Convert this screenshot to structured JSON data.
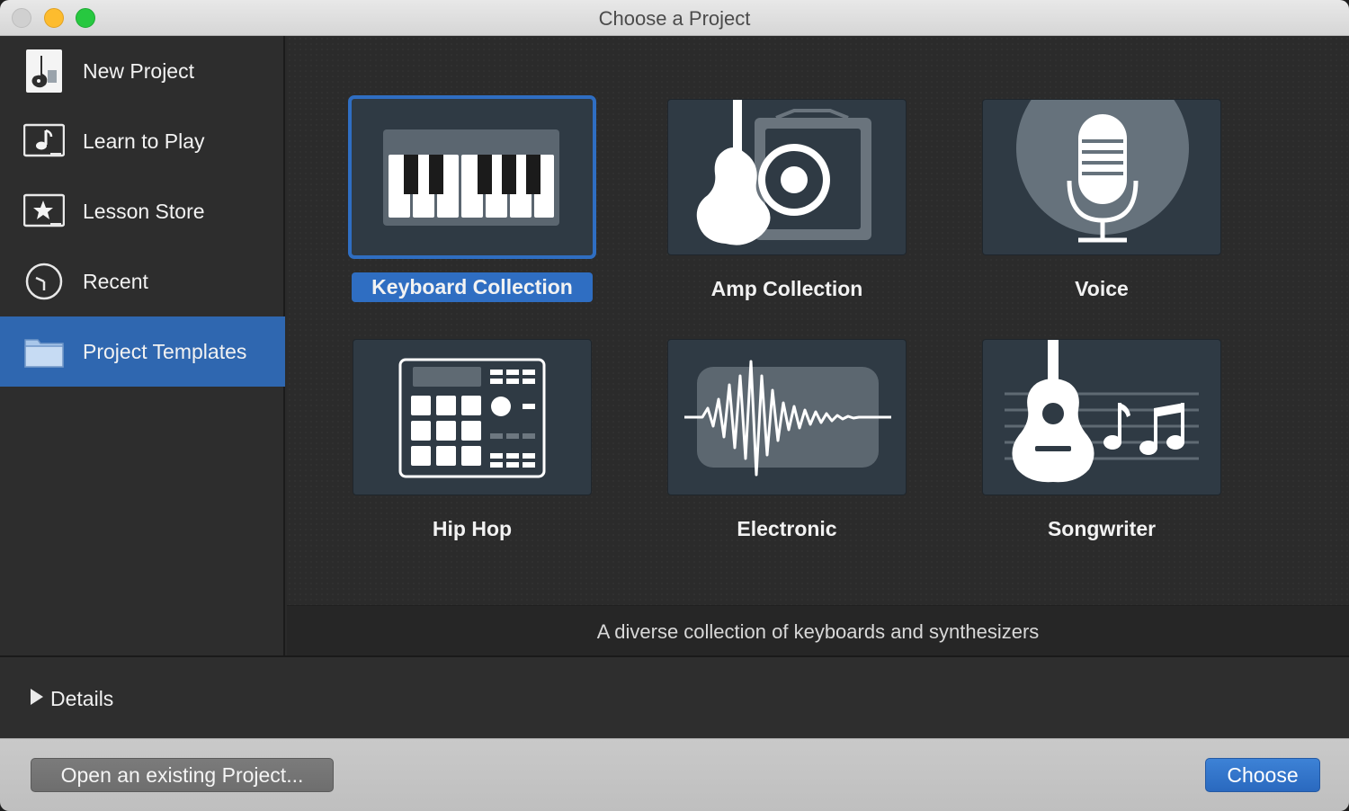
{
  "window": {
    "title": "Choose a Project"
  },
  "sidebar": {
    "items": [
      {
        "label": "New Project",
        "icon": "guitar-doc-icon",
        "selected": false
      },
      {
        "label": "Learn to Play",
        "icon": "music-note-icon",
        "selected": false
      },
      {
        "label": "Lesson Store",
        "icon": "star-icon",
        "selected": false
      },
      {
        "label": "Recent",
        "icon": "clock-icon",
        "selected": false
      },
      {
        "label": "Project Templates",
        "icon": "folder-icon",
        "selected": true
      }
    ]
  },
  "templates": [
    {
      "label": "Keyboard Collection",
      "icon": "keyboard-icon",
      "selected": true
    },
    {
      "label": "Amp Collection",
      "icon": "guitar-amp-icon",
      "selected": false
    },
    {
      "label": "Voice",
      "icon": "microphone-icon",
      "selected": false
    },
    {
      "label": "Hip Hop",
      "icon": "drum-machine-icon",
      "selected": false
    },
    {
      "label": "Electronic",
      "icon": "waveform-icon",
      "selected": false
    },
    {
      "label": "Songwriter",
      "icon": "acoustic-guitar-notes-icon",
      "selected": false
    }
  ],
  "description": "A diverse collection of keyboards and synthesizers",
  "details": {
    "label": "Details"
  },
  "footer": {
    "open_label": "Open an existing Project...",
    "choose_label": "Choose"
  },
  "colors": {
    "accent": "#2f6ec2",
    "sidebar_selected": "#2f67b0",
    "tile_bg": "#2f3a44"
  }
}
